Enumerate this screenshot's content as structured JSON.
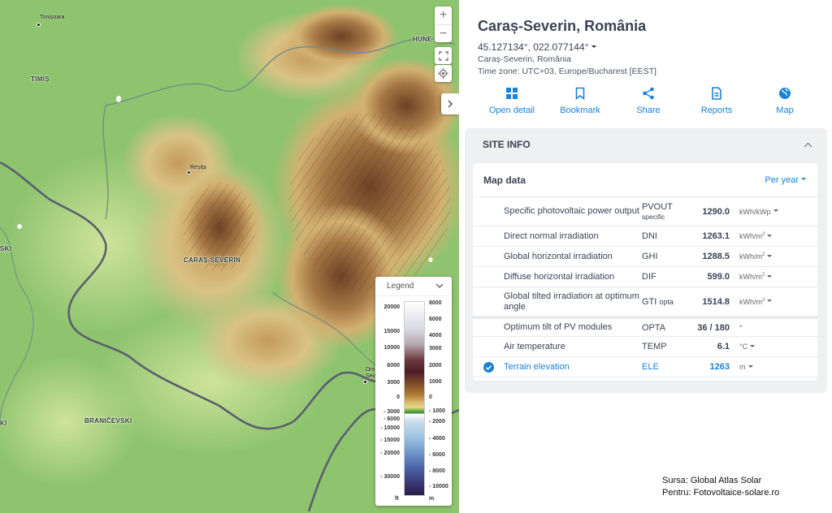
{
  "map": {
    "places": {
      "timisoara": "Timișoara",
      "timis": "TIMIȘ",
      "resita": "Reșița",
      "caras_severin": "CARAȘ-SEVERIN",
      "branicevski": "BRANIČEVSKI",
      "hunedoara": "HUNE",
      "drobeta": "Dro",
      "drobeta2": "Sev",
      "edge_left1": "SKI",
      "edge_left2": "KI"
    },
    "controls": {
      "zoom_in": "+",
      "zoom_out": "−"
    },
    "legend": {
      "title": "Legend",
      "ft_ticks": [
        "20000",
        "15000",
        "10000",
        "6000",
        "3000",
        "0",
        "- 3000",
        "- 6000",
        "- 10000",
        "- 15000",
        "- 20000",
        "- 30000"
      ],
      "m_ticks": [
        "8000",
        "6000",
        "4000",
        "3000",
        "2000",
        "1000",
        "0",
        "- 1000",
        "- 2000",
        "- 4000",
        "- 6000",
        "- 8000",
        "- 10000"
      ],
      "unit_ft": "ft",
      "unit_m": "m"
    },
    "credit": {
      "line1": "Sursa: Global Atlas Solar",
      "line2": "Pentru: Fotovoltaice-solare.ro"
    }
  },
  "panel": {
    "title": "Caraș-Severin, România",
    "coords": "45.127134°, 022.077144°",
    "region": "Caraș-Severin, România",
    "timezone": "Time zone: UTC+03, Europe/Bucharest [EEST]",
    "actions": [
      {
        "label": "Open detail",
        "icon": "grid-icon"
      },
      {
        "label": "Bookmark",
        "icon": "bookmark-icon"
      },
      {
        "label": "Share",
        "icon": "share-icon"
      },
      {
        "label": "Reports",
        "icon": "document-icon"
      },
      {
        "label": "Map",
        "icon": "globe-icon"
      }
    ],
    "site_info": {
      "heading": "SITE INFO",
      "map_data_title": "Map data",
      "period": "Per year",
      "rows": [
        {
          "label": "Specific photovoltaic power output",
          "abbr": "PVOUT",
          "abbr_sub": "specific",
          "value": "1290.0",
          "unit": "kWh/kWp",
          "unit_sup": ""
        },
        {
          "label": "Direct normal irradiation",
          "abbr": "DNI",
          "abbr_sub": "",
          "value": "1263.1",
          "unit": "kWh/m",
          "unit_sup": "2"
        },
        {
          "label": "Global horizontal irradiation",
          "abbr": "GHI",
          "abbr_sub": "",
          "value": "1288.5",
          "unit": "kWh/m",
          "unit_sup": "2"
        },
        {
          "label": "Diffuse horizontal irradiation",
          "abbr": "DIF",
          "abbr_sub": "",
          "value": "599.0",
          "unit": "kWh/m",
          "unit_sup": "2"
        },
        {
          "label": "Global tilted irradiation at optimum angle",
          "abbr": "GTI",
          "abbr_sub": "opta",
          "value": "1514.8",
          "unit": "kWh/m",
          "unit_sup": "2"
        },
        {
          "label": "Optimum tilt of PV modules",
          "abbr": "OPTA",
          "abbr_sub": "",
          "value": "36 /  180",
          "unit": "°",
          "unit_sup": ""
        },
        {
          "label": "Air temperature",
          "abbr": "TEMP",
          "abbr_sub": "",
          "value": "6.1",
          "unit": "°C",
          "unit_sup": ""
        },
        {
          "label": "Terrain elevation",
          "abbr": "ELE",
          "abbr_sub": "",
          "value": "1263",
          "unit": "m",
          "unit_sup": ""
        }
      ]
    }
  },
  "colors": {
    "accent": "#1c82d4",
    "text": "#3a4454",
    "panel_bg": "#eef0f2",
    "lowland": "#8fc46f",
    "mountain": "#8a5a36",
    "border_line": "#5b5f6e"
  }
}
